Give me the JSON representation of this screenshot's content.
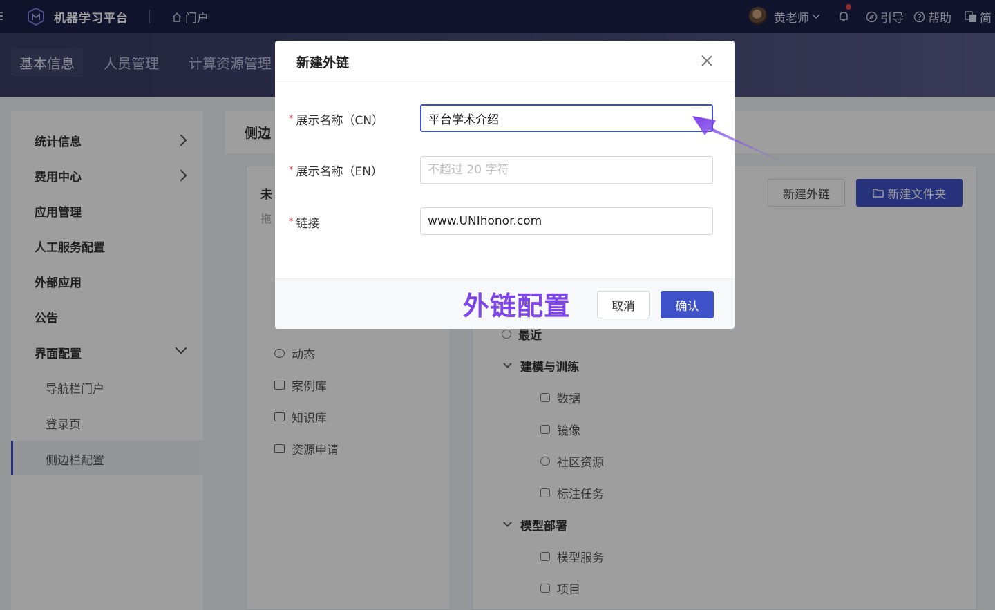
{
  "topbar": {
    "brand": "机器学习平台",
    "portal": "门户",
    "user": "黄老师",
    "guide": "引导",
    "help": "帮助",
    "lang": "简"
  },
  "subnav": {
    "tabs": [
      "基本信息",
      "人员管理",
      "计算资源管理"
    ]
  },
  "sidebar": {
    "items": [
      {
        "label": "统计信息"
      },
      {
        "label": "费用中心"
      },
      {
        "label": "应用管理"
      },
      {
        "label": "人工服务配置"
      },
      {
        "label": "外部应用"
      },
      {
        "label": "公告"
      },
      {
        "label": "界面配置"
      }
    ],
    "subitems": [
      {
        "label": "导航栏门户"
      },
      {
        "label": "登录页"
      },
      {
        "label": "侧边栏配置"
      }
    ]
  },
  "main": {
    "title": "侧边",
    "left_panel": {
      "title": "未",
      "subtitle": "拖",
      "items": [
        {
          "label": "动态",
          "icon": "activity-icon"
        },
        {
          "label": "案例库",
          "icon": "case-icon"
        },
        {
          "label": "知识库",
          "icon": "folder-icon"
        },
        {
          "label": "资源申请",
          "icon": "list-icon"
        }
      ]
    },
    "buttons": {
      "new_link": "新建外链",
      "new_folder": "新建文件夹"
    },
    "tree": {
      "recent": "最近",
      "group1": "建模与训练",
      "group1_items": [
        "数据",
        "镜像",
        "社区资源",
        "标注任务"
      ],
      "group2": "模型部署",
      "group2_items": [
        "模型服务",
        "项目"
      ]
    }
  },
  "modal": {
    "title": "新建外链",
    "fields": {
      "cn_label": "展示名称（CN）",
      "cn_value": "平台学术介绍",
      "en_label": "展示名称（EN）",
      "en_placeholder": "不超过 20 字符",
      "link_label": "链接",
      "link_value": "www.UNIhonor.com"
    },
    "annotation": "外链配置",
    "cancel": "取消",
    "confirm": "确认"
  },
  "colors": {
    "primary": "#3f51c9",
    "topbar": "#1e1f4a",
    "annotation": "#7d45e8",
    "required": "#e5484d"
  }
}
